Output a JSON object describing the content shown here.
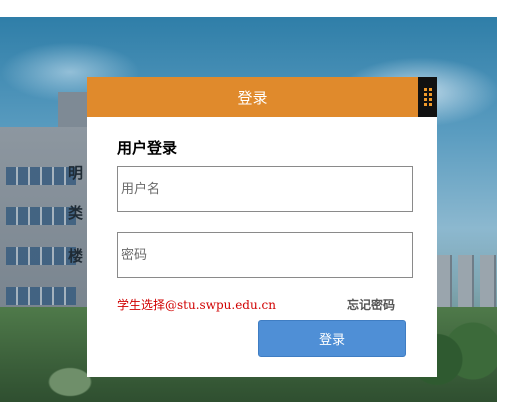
{
  "dialog": {
    "header_title": "登录",
    "form_title": "用户登录",
    "username_placeholder": "用户名",
    "password_placeholder": "密码",
    "hint_prefix": "学生选择",
    "hint_email": "@stu.swpu.edu.cn",
    "forgot_password": "忘记密码",
    "login_button": "登录"
  },
  "background": {
    "sign_chars": [
      "明",
      "类",
      "楼"
    ]
  },
  "colors": {
    "header": "#e08a2c",
    "button": "#4f8fd6",
    "hint": "#d00000"
  },
  "icons": {
    "qr_corner": "qr-code-icon"
  }
}
